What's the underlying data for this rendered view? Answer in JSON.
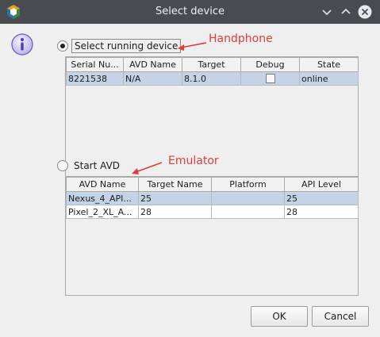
{
  "window": {
    "title": "Select device"
  },
  "running": {
    "label": "Select running device",
    "annotation": "Handphone",
    "columns": [
      "Serial Nu...",
      "AVD Name",
      "Target",
      "Debug",
      "State"
    ],
    "rows": [
      {
        "serial": "8221538",
        "avd": "N/A",
        "target": "8.1.0",
        "debug": false,
        "state": "online"
      }
    ]
  },
  "avd": {
    "label": "Start AVD",
    "annotation": "Emulator",
    "columns": [
      "AVD Name",
      "Target Name",
      "Platform",
      "API Level"
    ],
    "rows": [
      {
        "name": "Nexus_4_API...",
        "target": "25",
        "platform": "",
        "api": "25"
      },
      {
        "name": "Pixel_2_XL_A...",
        "target": "28",
        "platform": "",
        "api": "28"
      }
    ]
  },
  "buttons": {
    "ok": "OK",
    "cancel": "Cancel"
  },
  "colors": {
    "titlebar": "#484c51",
    "selection": "#c4d3e5",
    "annotation": "#e03c3c",
    "info_icon": "#6a5acd"
  }
}
